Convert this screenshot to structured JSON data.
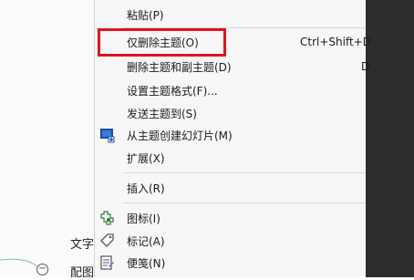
{
  "background": {
    "node_text_1": "文字",
    "node_text_2": "配图",
    "collapse_symbol": "−"
  },
  "context_menu": {
    "items": [
      {
        "label": "粘贴(P)",
        "shortcut": ""
      },
      {
        "label": "仅删除主题(O)",
        "shortcut": "Ctrl+Shift+D"
      },
      {
        "label": "删除主题和副主题(D)",
        "shortcut": "D"
      },
      {
        "label": "设置主题格式(F)...",
        "shortcut": ""
      },
      {
        "label": "发送主题到(S)",
        "shortcut": ""
      },
      {
        "label": "从主题创建幻灯片(M)",
        "shortcut": "",
        "icon": "slide-icon"
      },
      {
        "label": "扩展(X)",
        "shortcut": ""
      },
      {
        "label": "插入(R)",
        "shortcut": ""
      },
      {
        "label": "图标(I)",
        "shortcut": "",
        "icon": "puzzle-icon"
      },
      {
        "label": "标记(A)",
        "shortcut": "",
        "icon": "tag-icon"
      },
      {
        "label": "便笺(N)",
        "shortcut": "",
        "icon": "note-icon"
      }
    ]
  },
  "colors": {
    "highlight_border": "#e0141e",
    "menu_background": "#f7f7f7",
    "dark_panel": "#2d2d2d"
  }
}
